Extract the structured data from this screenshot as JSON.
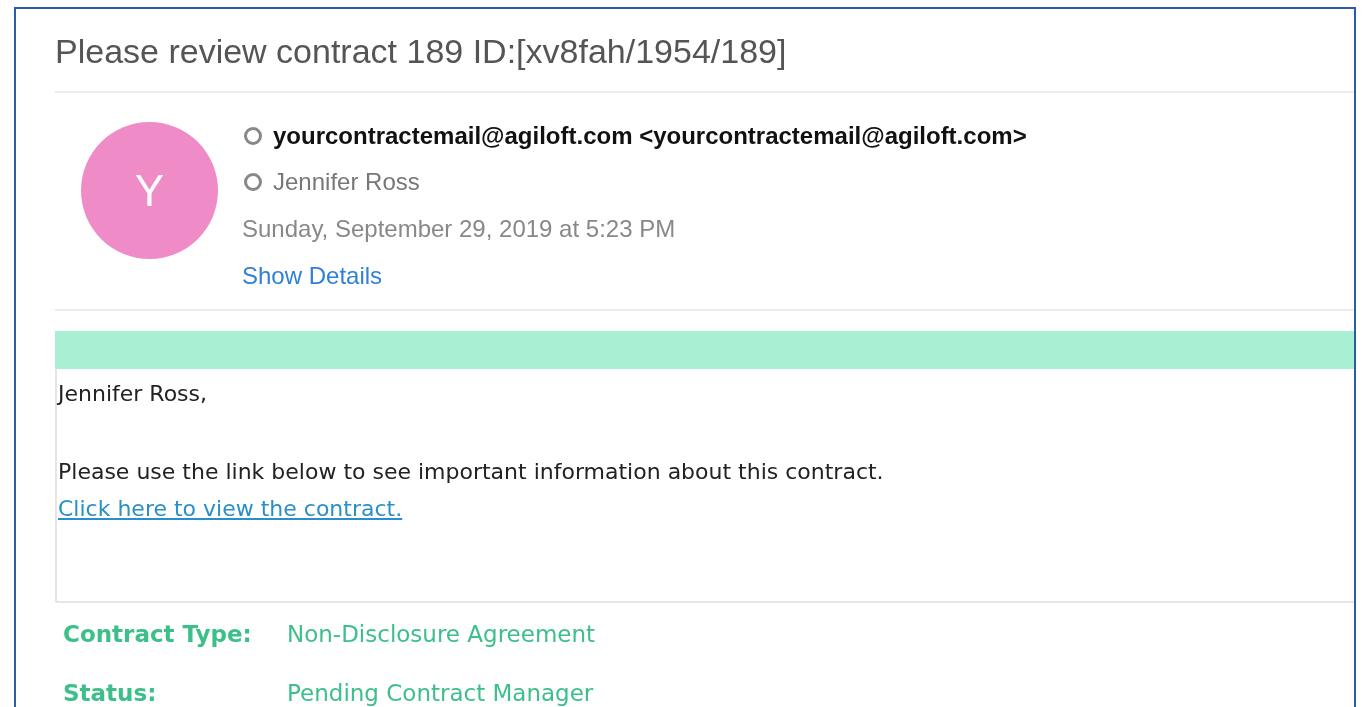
{
  "message": {
    "subject": "Please review contract 189 ID:[xv8fah/1954/189]",
    "sender": {
      "initial": "Y",
      "address": "yourcontractemail@agiloft.com <yourcontractemail@agiloft.com>"
    },
    "recipient": "Jennifer Ross",
    "date": "Sunday, September 29, 2019 at 5:23 PM",
    "details_link": "Show Details"
  },
  "body": {
    "greeting": "Jennifer Ross,",
    "paragraph": "Please use the link below to see important information about this contract.",
    "link": "Click here to view the contract."
  },
  "fields": [
    {
      "label": "Contract Type:",
      "value": "Non-Disclosure Agreement"
    },
    {
      "label": "Status:",
      "value": "Pending Contract Manager"
    }
  ]
}
